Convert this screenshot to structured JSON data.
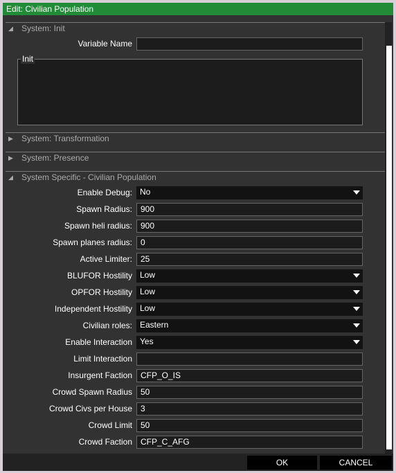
{
  "window": {
    "title": "Edit: Civilian Population"
  },
  "sections": [
    {
      "label": "System: Init",
      "expanded": true
    },
    {
      "label": "System: Transformation",
      "expanded": false
    },
    {
      "label": "System: Presence",
      "expanded": false
    },
    {
      "label": "System Specific - Civilian Population",
      "expanded": true
    }
  ],
  "init": {
    "variable_name_label": "Variable Name",
    "variable_name_value": "",
    "init_label": "Init",
    "init_value": ""
  },
  "fields": [
    {
      "label": "Enable Debug:",
      "value": "No",
      "type": "dropdown"
    },
    {
      "label": "Spawn Radius:",
      "value": "900",
      "type": "text"
    },
    {
      "label": "Spawn heli radius:",
      "value": "900",
      "type": "text"
    },
    {
      "label": "Spawn planes radius:",
      "value": "0",
      "type": "text"
    },
    {
      "label": "Active Limiter:",
      "value": "25",
      "type": "text"
    },
    {
      "label": "BLUFOR Hostility",
      "value": "Low",
      "type": "dropdown"
    },
    {
      "label": "OPFOR Hostility",
      "value": "Low",
      "type": "dropdown"
    },
    {
      "label": "Independent Hostility",
      "value": "Low",
      "type": "dropdown"
    },
    {
      "label": "Civilian roles:",
      "value": "Eastern",
      "type": "dropdown"
    },
    {
      "label": "Enable Interaction",
      "value": "Yes",
      "type": "dropdown"
    },
    {
      "label": "Limit Interaction",
      "value": "",
      "type": "text"
    },
    {
      "label": "Insurgent Faction",
      "value": "CFP_O_IS",
      "type": "text"
    },
    {
      "label": "Crowd Spawn Radius",
      "value": "50",
      "type": "text"
    },
    {
      "label": "Crowd Civs per House",
      "value": "3",
      "type": "text"
    },
    {
      "label": "Crowd Limit",
      "value": "50",
      "type": "text"
    },
    {
      "label": "Crowd Faction",
      "value": "CFP_C_AFG",
      "type": "text"
    }
  ],
  "buttons": {
    "ok": "OK",
    "cancel": "CANCEL"
  },
  "colors": {
    "title_bar": "#228b38"
  }
}
